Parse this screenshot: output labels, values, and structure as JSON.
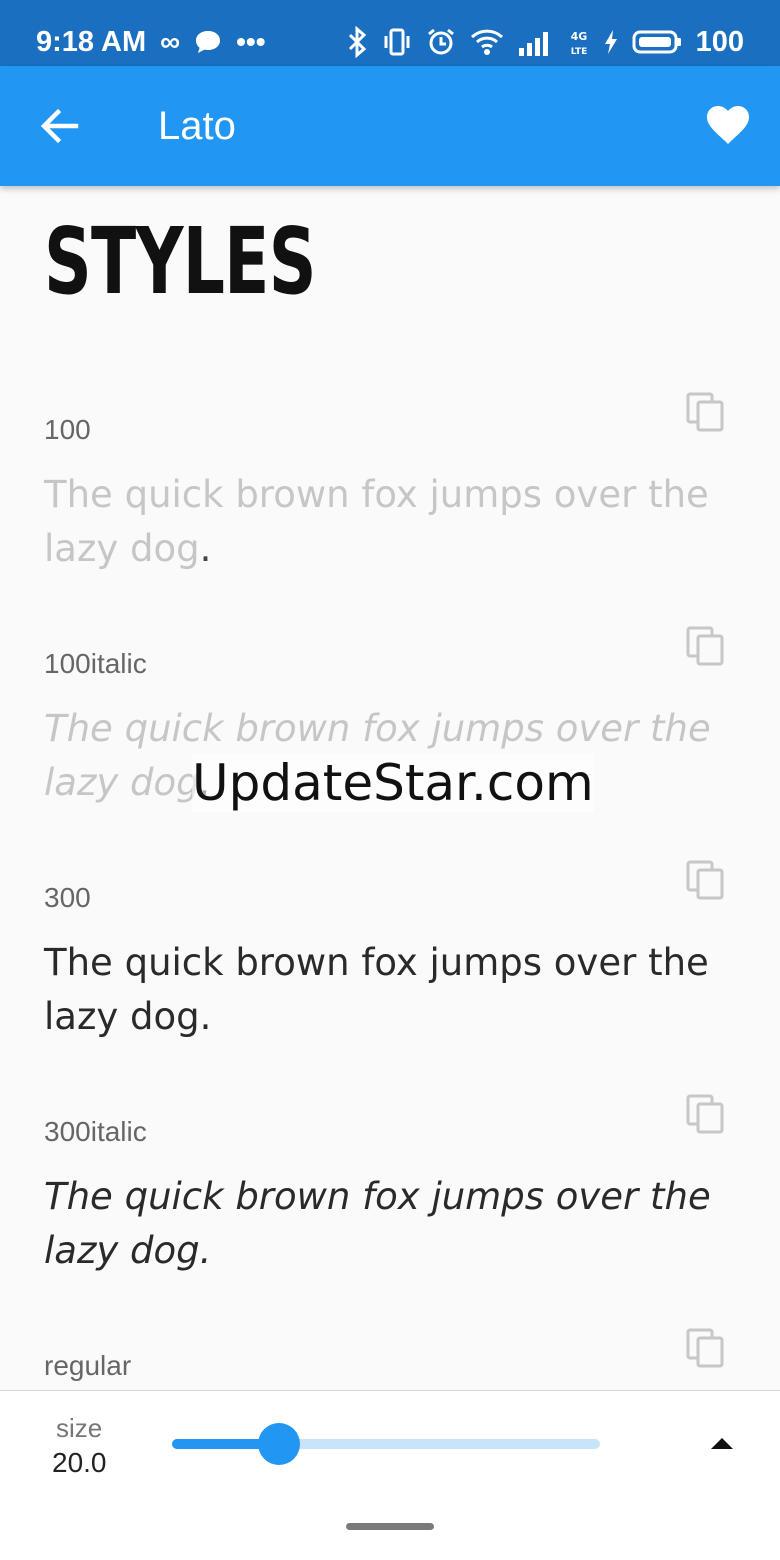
{
  "status_bar": {
    "time": "9:18 AM",
    "notification_icons": [
      "infinity-icon",
      "chat-bubble-icon",
      "more-dots-icon"
    ],
    "system_icons": [
      "bluetooth-icon",
      "vibrate-icon",
      "alarm-icon",
      "wifi-icon",
      "signal-icon",
      "network-4g-lte-icon",
      "charging-bolt-icon",
      "battery-icon"
    ],
    "battery": "100"
  },
  "app_bar": {
    "title": "Lato",
    "back_icon": "arrow-back-icon",
    "favorite_icon": "heart-icon",
    "color": "#2196f3"
  },
  "section": {
    "heading": "STYLES"
  },
  "styles": [
    {
      "name": "100",
      "sample": "The quick brown fox jumps over the lazy dog",
      "punct": "."
    },
    {
      "name": "100italic",
      "sample": "The quick brown fox jumps over the lazy dog",
      "punct": "."
    },
    {
      "name": "300",
      "sample": "The quick brown fox jumps over the lazy dog."
    },
    {
      "name": "300italic",
      "sample": "The quick brown fox jumps over the lazy dog."
    },
    {
      "name": "regular"
    }
  ],
  "watermark": "UpdateStar.com",
  "size_control": {
    "label": "size",
    "value": "20.0",
    "slider_fraction": 0.25,
    "accent": "#2196f3",
    "expand_icon": "triangle-up-icon"
  }
}
